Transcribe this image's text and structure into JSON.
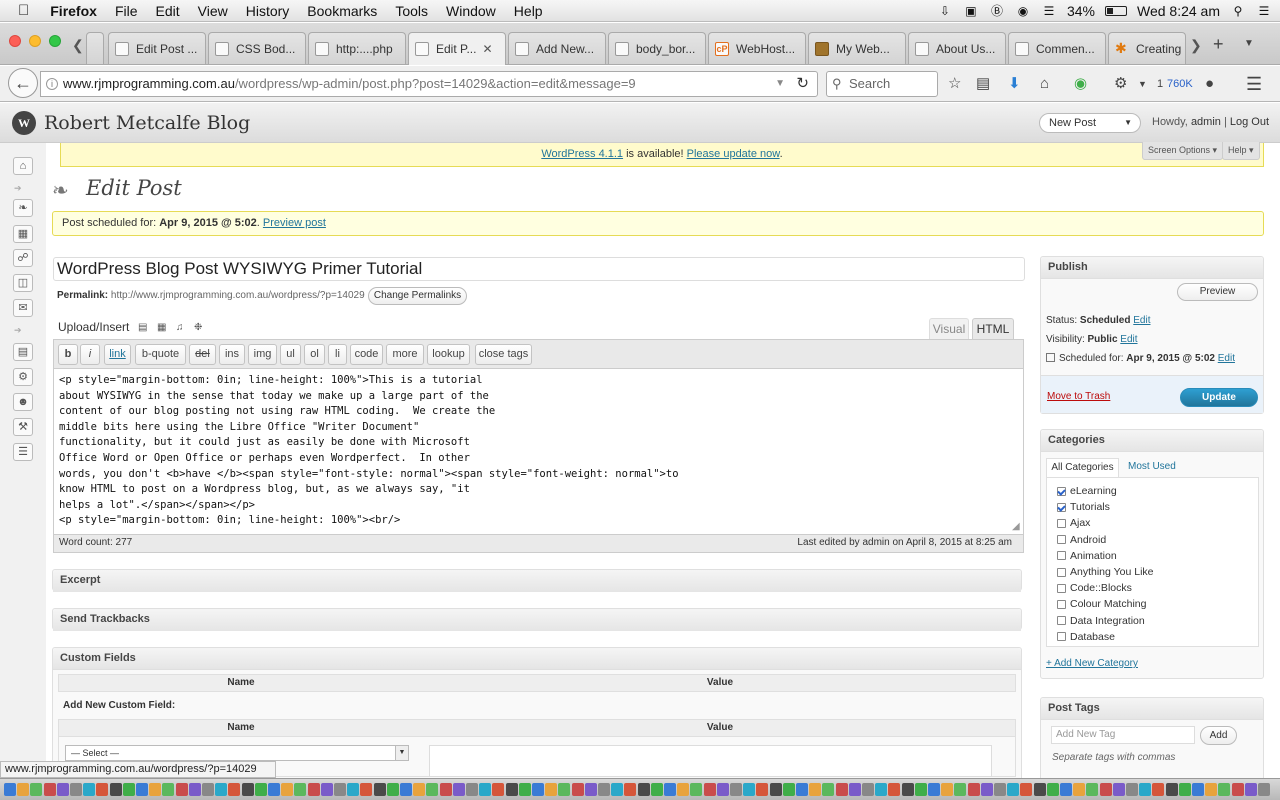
{
  "menubar": {
    "apple": "",
    "items": [
      "Firefox",
      "File",
      "Edit",
      "View",
      "History",
      "Bookmarks",
      "Tools",
      "Window",
      "Help"
    ],
    "battery": "34%",
    "clock": "Wed 8:24 am"
  },
  "tabs": [
    {
      "label": "Edit Post ..."
    },
    {
      "label": "CSS Bod..."
    },
    {
      "label": "http:....php"
    },
    {
      "label": "Edit P..."
    },
    {
      "label": "Add New..."
    },
    {
      "label": "body_bor..."
    },
    {
      "label": "WebHost..."
    },
    {
      "label": "My Web..."
    },
    {
      "label": "About Us..."
    },
    {
      "label": "Commen..."
    },
    {
      "label": "Creating"
    }
  ],
  "nav": {
    "url_host": "www.rjmprogramming.com.au",
    "url_rest": "/wordpress/wp-admin/post.php?post=14029&action=edit&message=9",
    "search_placeholder": "Search",
    "counter_a": "1",
    "counter_b": "760K"
  },
  "wp": {
    "blog_name": "Robert Metcalfe Blog",
    "new_post": "New Post",
    "howdy": "Howdy,",
    "user": "admin",
    "sep": "|",
    "logout": "Log Out",
    "update_link": "WordPress 4.1.1",
    "update_mid": " is available! ",
    "update_now": "Please update now",
    "update_end": ".",
    "screen_options": "Screen Options",
    "help": "Help",
    "page_title": "Edit Post",
    "msg_prefix": "Post scheduled for: ",
    "msg_date": "Apr 9, 2015 @ 5:02",
    "msg_dot": ". ",
    "msg_link": "Preview post"
  },
  "post": {
    "title": "WordPress Blog Post WYSIWYG Primer Tutorial",
    "permalink_label": "Permalink:",
    "permalink": "http://www.rjmprogramming.com.au/wordpress/?p=14029",
    "change_permalinks": "Change Permalinks",
    "upload_insert": "Upload/Insert",
    "tab_visual": "Visual",
    "tab_html": "HTML",
    "quicktags": [
      "b",
      "i",
      "link",
      "b-quote",
      "del",
      "ins",
      "img",
      "ul",
      "ol",
      "li",
      "code",
      "more",
      "lookup",
      "close tags"
    ],
    "content": "<p style=\"margin-bottom: 0in; line-height: 100%\">This is a tutorial\nabout WYSIWYG in the sense that today we make up a large part of the\ncontent of our blog posting not using raw HTML coding.  We create the\nmiddle bits here using the Libre Office \"Writer Document\"\nfunctionality, but it could just as easily be done with Microsoft\nOffice Word or Open Office or perhaps even Wordperfect.  In other\nwords, you don't <b>have </b><span style=\"font-style: normal\"><span style=\"font-weight: normal\">to\nknow HTML to post on a Wordpress blog, but, as we always say, \"it\nhelps a lot\".</span></span></p>\n<p style=\"margin-bottom: 0in; line-height: 100%\"><br/>",
    "word_count": "Word count: 277",
    "last_edited": "Last edited by admin on April 8, 2015 at 8:25 am"
  },
  "boxes": {
    "excerpt": "Excerpt",
    "trackbacks": "Send Trackbacks",
    "custom_fields": "Custom Fields",
    "cf_name": "Name",
    "cf_value": "Value",
    "cf_add": "Add New Custom Field:",
    "cf_select": "— Select —"
  },
  "publish": {
    "title": "Publish",
    "preview": "Preview",
    "status_label": "Status: ",
    "status_value": "Scheduled",
    "visibility_label": "Visibility: ",
    "visibility_value": "Public",
    "edit": "Edit",
    "scheduled_label": "Scheduled for: ",
    "scheduled_value": "Apr 9, 2015 @ 5:02",
    "trash": "Move to Trash",
    "update": "Update"
  },
  "categories": {
    "title": "Categories",
    "tab_all": "All Categories",
    "tab_most": "Most Used",
    "items": [
      {
        "label": "eLearning",
        "checked": true
      },
      {
        "label": "Tutorials",
        "checked": true
      },
      {
        "label": "Ajax",
        "checked": false
      },
      {
        "label": "Android",
        "checked": false
      },
      {
        "label": "Animation",
        "checked": false
      },
      {
        "label": "Anything You Like",
        "checked": false
      },
      {
        "label": "Code::Blocks",
        "checked": false
      },
      {
        "label": "Colour Matching",
        "checked": false
      },
      {
        "label": "Data Integration",
        "checked": false
      },
      {
        "label": "Database",
        "checked": false
      }
    ],
    "add_new": "+ Add New Category"
  },
  "tags": {
    "title": "Post Tags",
    "placeholder": "Add New Tag",
    "add": "Add",
    "hint": "Separate tags with commas"
  },
  "statusbar": "www.rjmprogramming.com.au/wordpress/?p=14029",
  "colors": {
    "accent": "#21759b",
    "update_btn": "#21759b",
    "notice": "#fffbcc"
  }
}
